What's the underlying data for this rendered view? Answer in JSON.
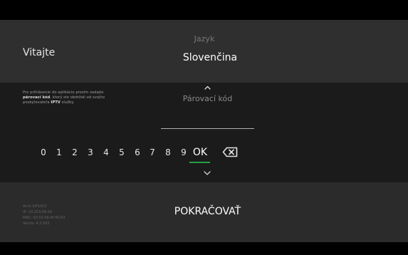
{
  "header": {
    "welcome_title": "Vitajte"
  },
  "language": {
    "caption": "Jazyk",
    "selected": "Slovenčina",
    "icons": {
      "up": "chevron-up-icon"
    }
  },
  "pairing": {
    "instruction_part1": "Pre prihlásenie do aplikácie prosím zadajte",
    "instruction_bold1": "párovací kód",
    "instruction_part2": ", ktorý ste obdržali od svojho",
    "instruction_part3": "poskytovateľa",
    "instruction_bold2": "IPTV",
    "instruction_part4": " služby.",
    "field_placeholder": "Párovací kód",
    "field_value": ""
  },
  "keypad": {
    "digits": [
      "0",
      "1",
      "2",
      "3",
      "4",
      "5",
      "6",
      "7",
      "8",
      "9"
    ],
    "ok_label": "OK",
    "backspace_icon": "backspace-icon",
    "down_icon": "chevron-down-icon"
  },
  "device": {
    "lines": [
      "Arris VIP1003",
      "IP: 10.253.68.99",
      "MAC: 00:02:9b:9f:40:63",
      "Verzia: 4.2.003"
    ]
  },
  "actions": {
    "continue_label": "POKRAČOVAŤ"
  },
  "colors": {
    "accent": "#23a044",
    "background": "#000000",
    "top_panel": "#2f2f2f",
    "middle_panel": "#1b1b1b",
    "bottom_panel": "#2b2b2b"
  }
}
